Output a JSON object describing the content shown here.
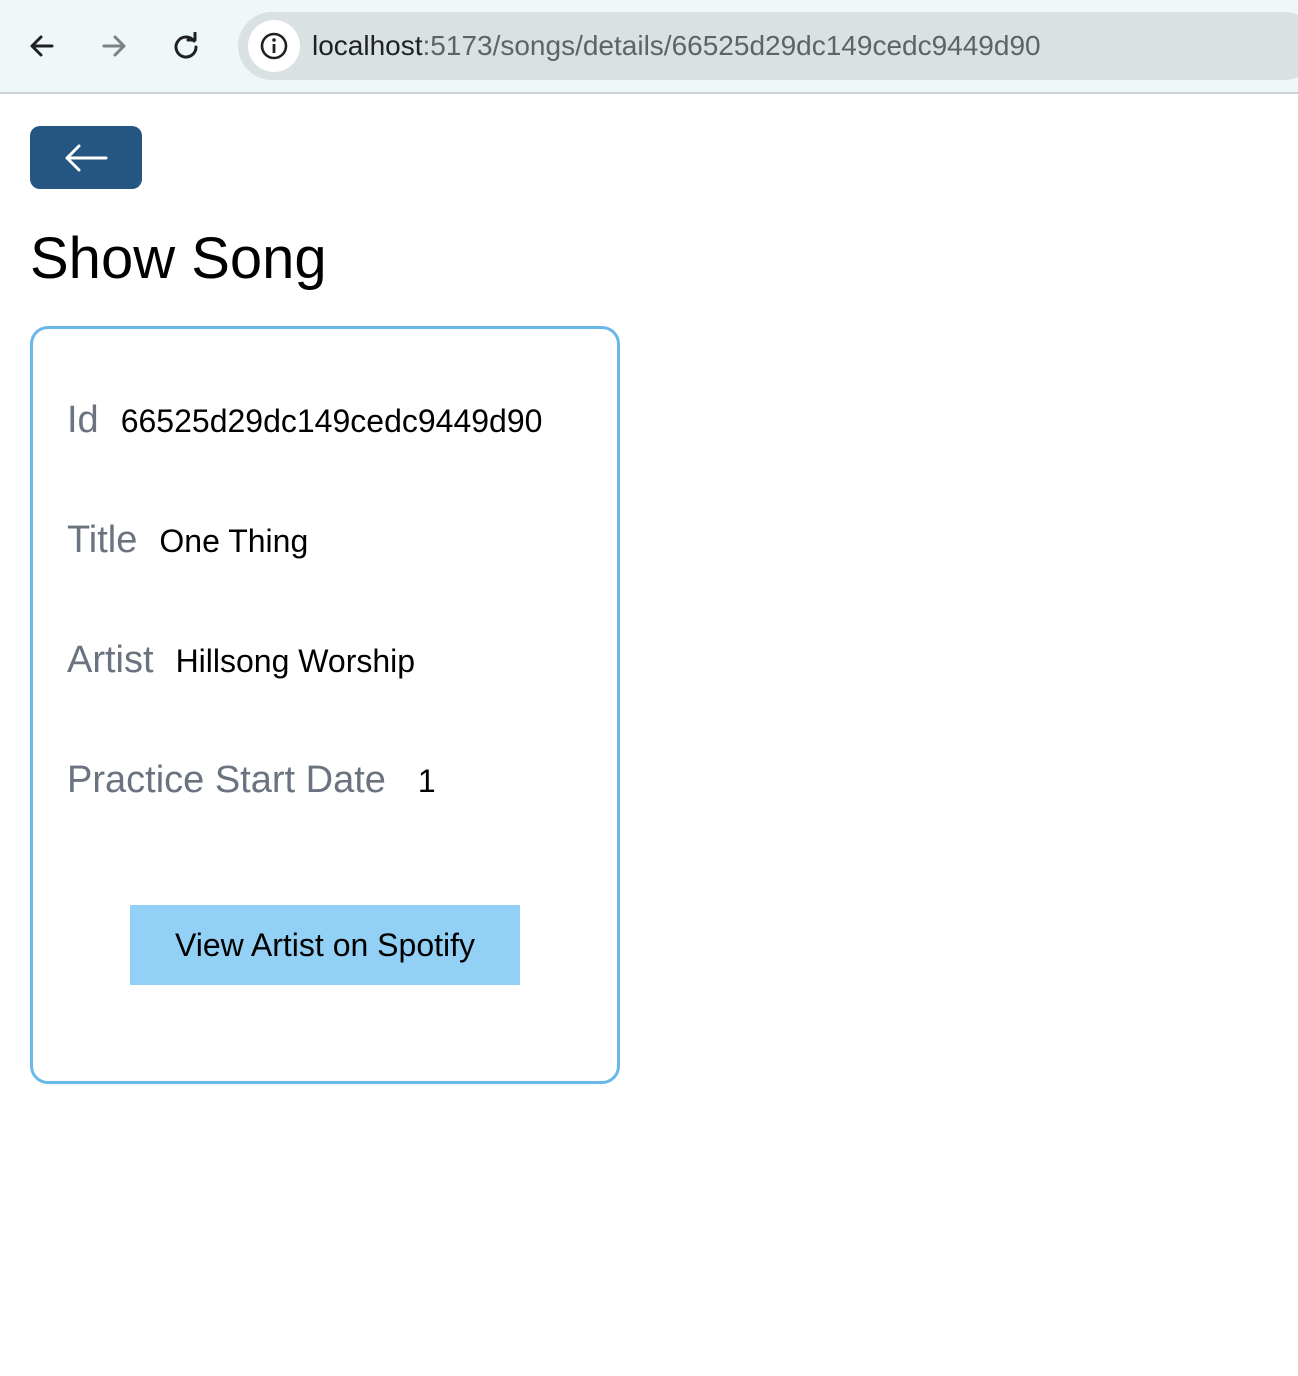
{
  "browser": {
    "url_host": "localhost",
    "url_path": ":5173/songs/details/66525d29dc149cedc9449d90",
    "icons": {
      "back": "arrow-left-icon",
      "forward": "arrow-right-icon",
      "reload": "reload-icon",
      "info": "info-icon"
    }
  },
  "page": {
    "back_button_icon": "arrow-left-icon",
    "title": "Show Song"
  },
  "song": {
    "id_label": "Id",
    "id_value": "66525d29dc149cedc9449d90",
    "title_label": "Title",
    "title_value": "One Thing",
    "artist_label": "Artist",
    "artist_value": "Hillsong Worship",
    "date_label": "Practice Start Date",
    "date_value": "1"
  },
  "actions": {
    "spotify_label": "View Artist on Spotify"
  },
  "colors": {
    "back_button": "#245681",
    "card_border": "#6ab8ea",
    "spotify_button": "#93d0f5",
    "label_gray": "#6b7280"
  }
}
